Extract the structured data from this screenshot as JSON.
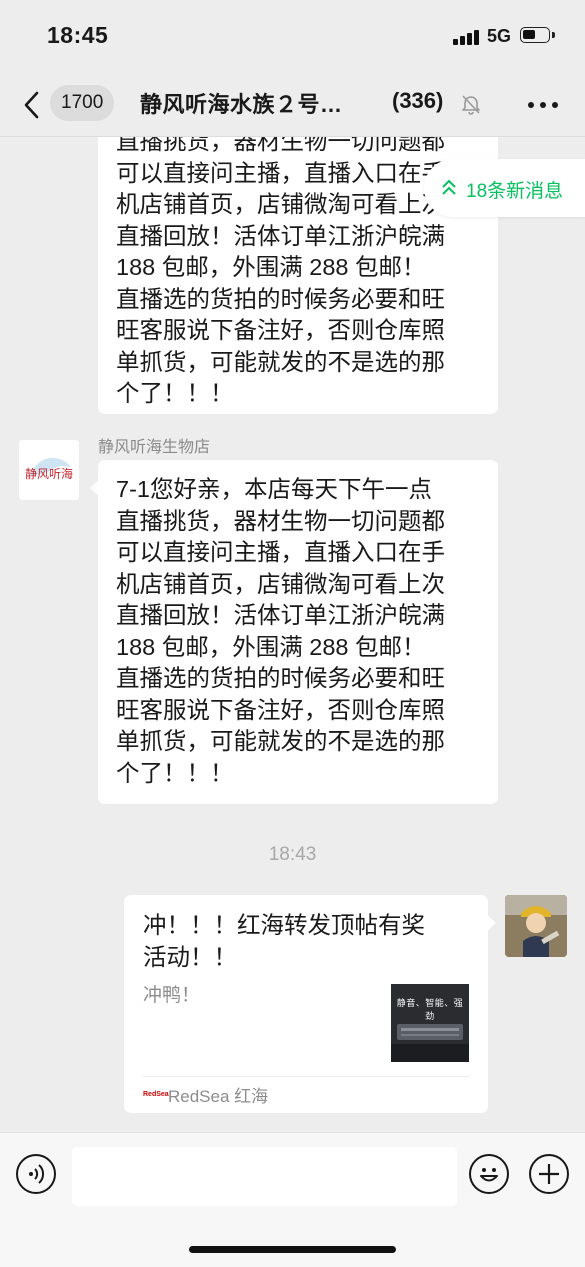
{
  "status_bar": {
    "time": "18:45",
    "network": "5G",
    "signal_icon": "signal-bars-icon",
    "battery_icon": "battery-icon"
  },
  "nav": {
    "back_icon": "chevron-left-icon",
    "unread_badge": "1700",
    "title": "静风听海水族２号…",
    "member_count": "(336)",
    "mute_icon": "bell-muted-icon",
    "more_icon": "ellipsis-icon"
  },
  "new_messages_banner": {
    "icon": "double-chevron-up-icon",
    "text": "18条新消息",
    "color": "#07c160"
  },
  "messages": {
    "partial": {
      "lines": [
        "直播挑货，器材生物一切问题都",
        "可以直接问主播，直播入口在手",
        "机店铺首页，店铺微淘可看上次",
        "直播回放！活体订单江浙沪皖满",
        "188 包邮，外围满 288 包邮！",
        "直播选的货拍的时候务必要和旺",
        "旺客服说下备注好，否则仓库照",
        "单抓货，可能就发的不是选的那",
        "个了！！！"
      ]
    },
    "shop": {
      "sender": "静风听海生物店",
      "avatar_text": "静风听海",
      "lines": [
        "7-1您好亲，本店每天下午一点",
        "直播挑货，器材生物一切问题都",
        "可以直接问主播，直播入口在手",
        "机店铺首页，店铺微淘可看上次",
        "直播回放！活体订单江浙沪皖满",
        "188 包邮，外围满 288 包邮！",
        "直播选的货拍的时候务必要和旺",
        "旺客服说下备注好，否则仓库照",
        "单抓货，可能就发的不是选的那",
        "个了！！！"
      ]
    },
    "timestamp": "18:43",
    "link_card": {
      "title_lines": [
        "冲！！！红海转发顶帖有奖",
        "活动！！"
      ],
      "description": "冲鸭！",
      "thumbnail_text": "静音、智能、强劲",
      "source_icon_text": "RedSea",
      "source": "RedSea 红海"
    }
  },
  "input_bar": {
    "voice_icon": "voice-icon",
    "placeholder": "",
    "emoji_icon": "emoji-icon",
    "plus_icon": "plus-circle-icon"
  }
}
